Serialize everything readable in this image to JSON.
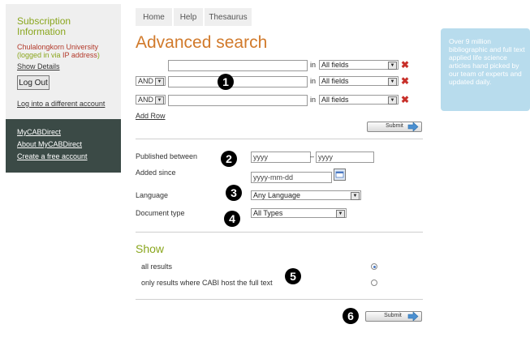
{
  "sidebar": {
    "title": "Subscription Information",
    "institution": "Chulalongkorn University",
    "login_note_prefix": "(logged in via ",
    "login_note_ip": "IP address",
    "login_note_suffix": ")",
    "show_details": "Show Details",
    "logout_label": "Log Out",
    "log_diff": "Log into a different account",
    "links": [
      "MyCABDirect",
      "About MyCABDirect",
      "Create a free account"
    ]
  },
  "tabs": [
    "Home",
    "Help",
    "Thesaurus"
  ],
  "page_title": "Advanced search",
  "search_rows": [
    {
      "operator": "",
      "in_label": "in",
      "field": "All fields"
    },
    {
      "operator": "AND",
      "in_label": "in",
      "field": "All fields"
    },
    {
      "operator": "AND",
      "in_label": "in",
      "field": "All fields"
    }
  ],
  "add_row": "Add Row",
  "submit_label": "Submit",
  "filters": {
    "published_label": "Published between",
    "from_placeholder": "yyyy",
    "dash": "–",
    "to_placeholder": "yyyy",
    "added_label": "Added since",
    "added_placeholder": "yyyy-mm-dd",
    "language_label": "Language",
    "language_value": "Any Language",
    "doctype_label": "Document type",
    "doctype_value": "All Types"
  },
  "show": {
    "title": "Show",
    "option_all": "all results",
    "option_fulltext": "only results where CABI host the full text",
    "selected": "all"
  },
  "badges": [
    "❶",
    "❷",
    "❸",
    "❹",
    "❺",
    "❻"
  ],
  "badge_numbers": [
    "1",
    "2",
    "3",
    "4",
    "5",
    "6"
  ],
  "info_panel": {
    "text": "Over 9 million bibliographic and full text applied life science articles hand picked by our team of experts and updated daily."
  },
  "colors": {
    "accent_orange": "#d17a2b",
    "accent_green": "#8aa61e",
    "sidebar_dark": "#3b4a46",
    "info_blue": "#b8dced",
    "remove_red": "#c8302a"
  }
}
